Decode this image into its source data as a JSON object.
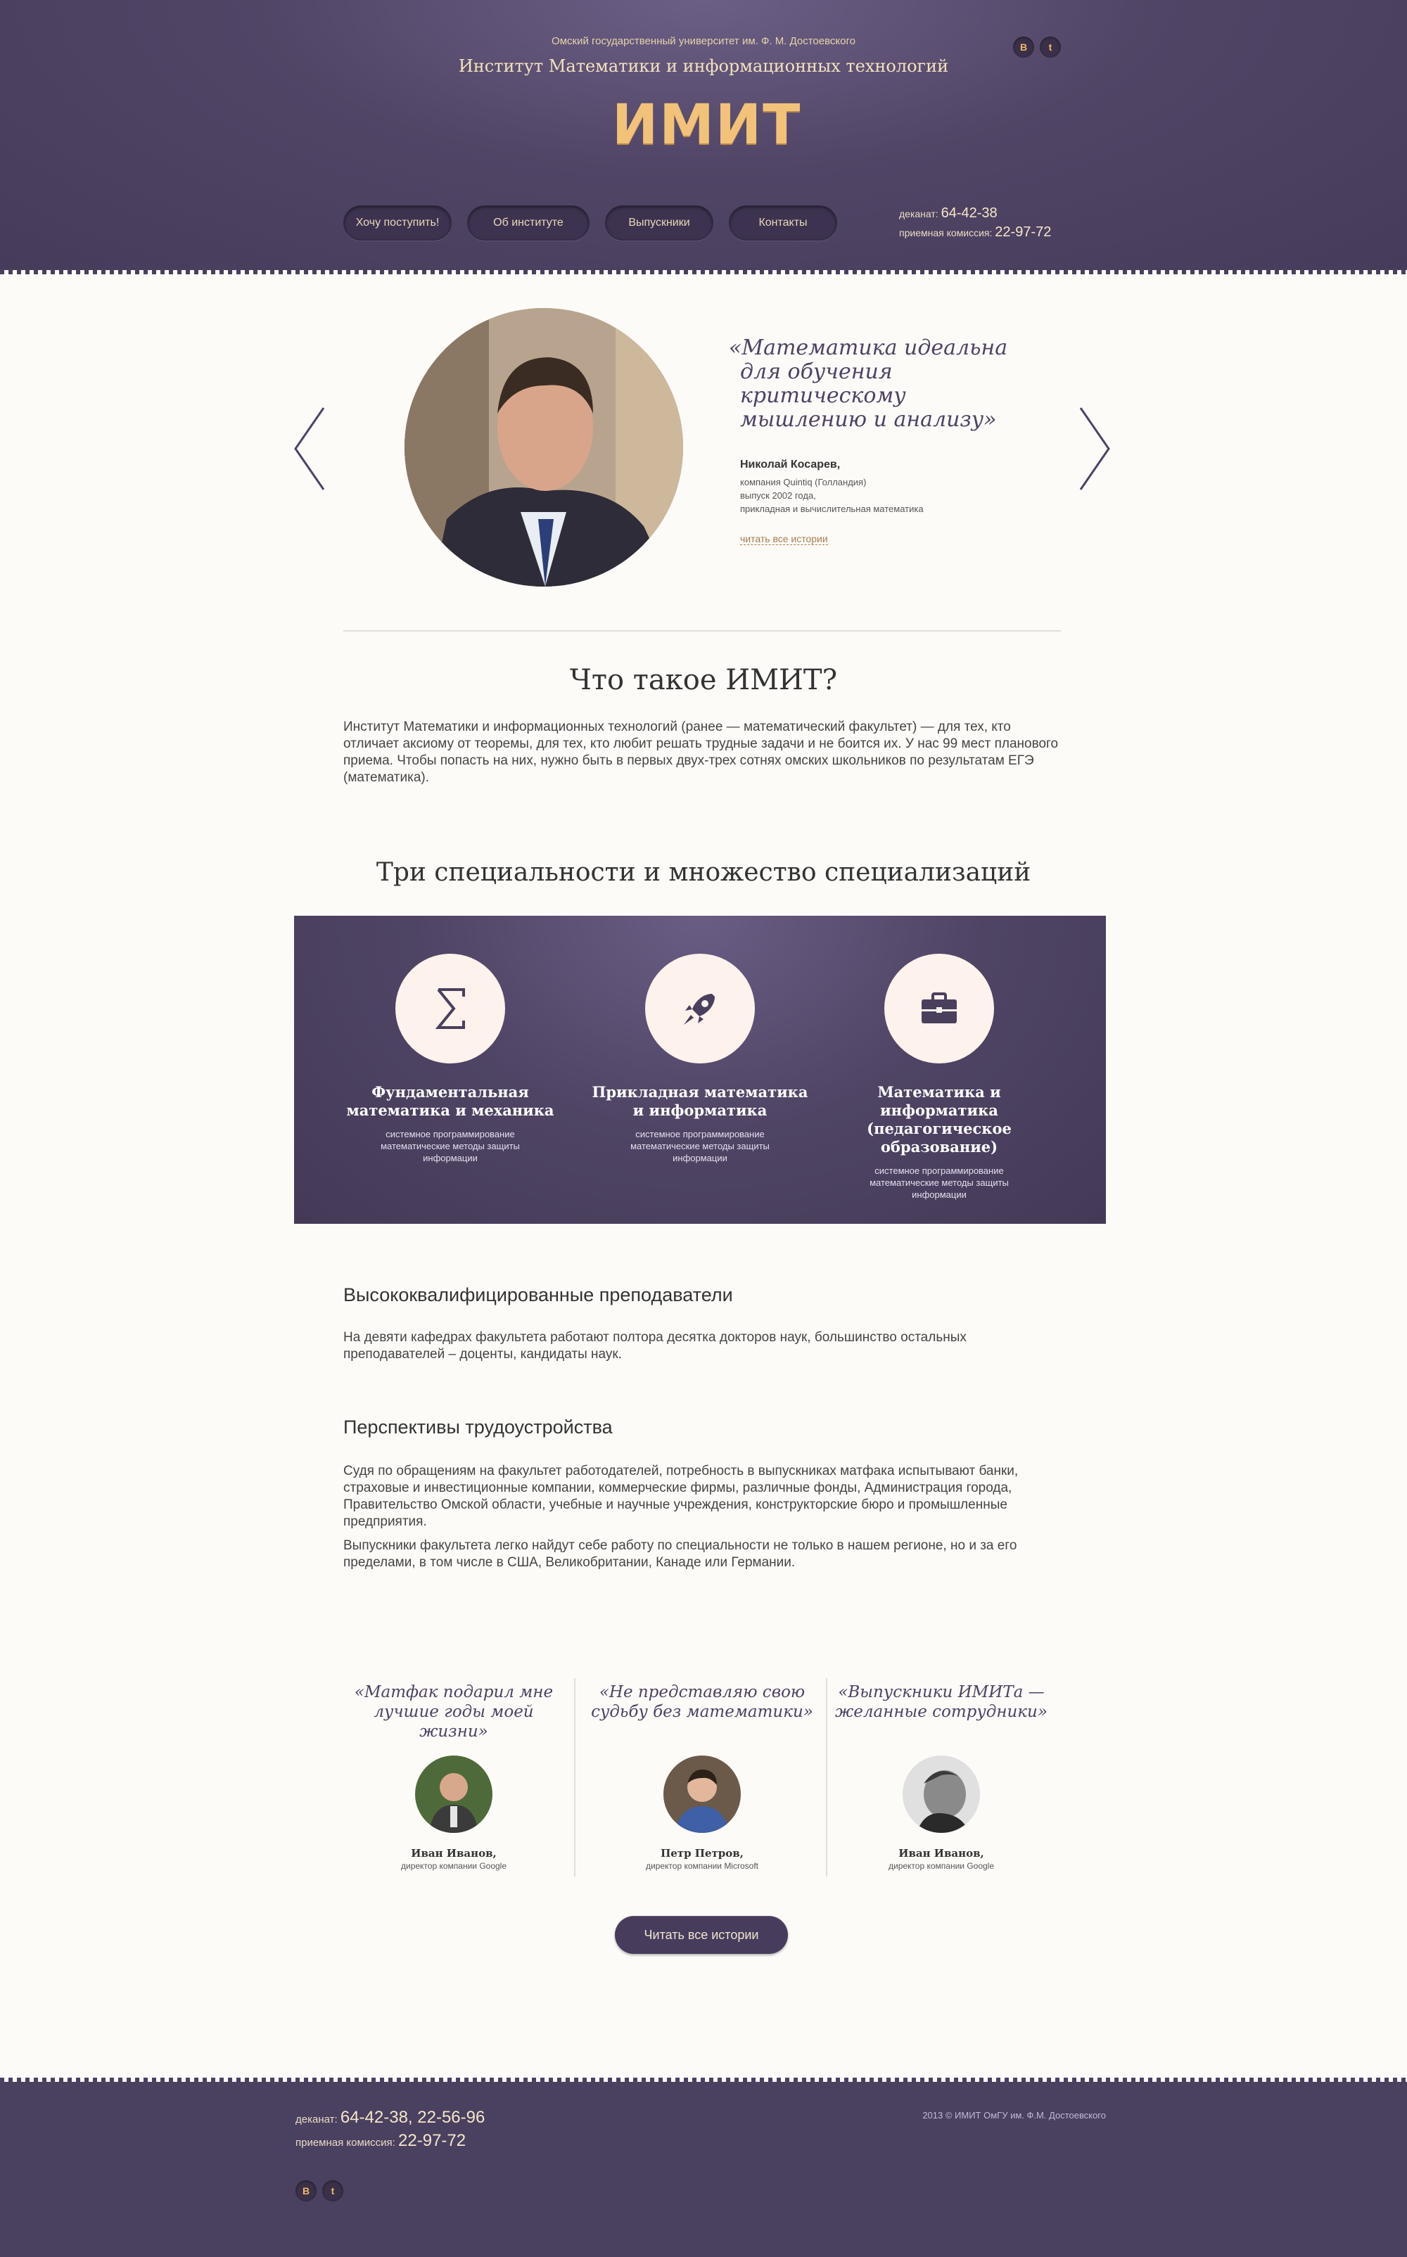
{
  "header": {
    "university": "Омский государственный университет им. Ф. М. Достоевского",
    "institute": "Институт Математики и информационных технологий",
    "logo": "ИМИТ",
    "socials": [
      {
        "icon": "vk-icon",
        "label": "B"
      },
      {
        "icon": "twitter-icon",
        "label": "t"
      }
    ],
    "nav": [
      "Хочу поступить!",
      "Об институте",
      "Выпускники",
      "Контакты"
    ],
    "dean_label": "деканат:",
    "dean_phone": "64-42-38",
    "admission_label": "приемная комиссия:",
    "admission_phone": "22-97-72"
  },
  "slider": {
    "quote": "«Математика идеальна для обучения критическому мышлению и анализу»",
    "quote_lines": [
      "«Математика идеальна",
      "для обучения",
      "критическому",
      "мышлению и анализу»"
    ],
    "name": "Николай Косарев,",
    "company": "компания Quintiq (Голландия)",
    "graduation": "выпуск 2002 года,",
    "specialty": "прикладная и вычислительная математика",
    "link": "читать все истории"
  },
  "about": {
    "title": "Что такое ИМИТ?",
    "text": "Институт Математики и информационных технологий (ранее — математический факультет) — для тех, кто отличает аксиому от теоремы, для тех, кто любит решать трудные задачи и не боится их. У нас 99 мест планового приема. Чтобы попасть на них, нужно быть в первых двух-трех сотнях омских школьников по результатам ЕГЭ (математика)."
  },
  "specialties": {
    "title": "Три специальности и множество специализаций",
    "items": [
      {
        "icon": "sigma-icon",
        "title_lines": [
          "Фундаментальная",
          "математика и механика"
        ],
        "lines": [
          "системное программирование",
          "математические методы защиты",
          "информации"
        ]
      },
      {
        "icon": "rocket-icon",
        "title_lines": [
          "Прикладная математика",
          "и информатика"
        ],
        "lines": [
          "системное программирование",
          "математические методы защиты",
          "информации"
        ]
      },
      {
        "icon": "briefcase-icon",
        "title_lines": [
          "Математика и информатика",
          "(педагогическое образование)"
        ],
        "lines": [
          "системное программирование",
          "математические методы защиты",
          "информации"
        ]
      }
    ]
  },
  "teachers": {
    "title": "Высококвалифицированные преподаватели",
    "text": "На девяти кафедрах факультета работают полтора десятка докторов наук, большинство остальных преподавателей – доценты, кандидаты наук."
  },
  "careers": {
    "title": "Перспективы трудоустройства",
    "p1": "Судя по обращениям на факультет работодателей, потребность в выпускниках матфака испытывают банки, страховые и инвестиционные компании, коммерческие фирмы, различные фонды, Администрация города, Правительство Омской области, учебные и научные учреждения, конструкторские бюро и промышленные предприятия.",
    "p2": "Выпускники факультета легко найдут себе работу по специальности не только в нашем регионе, но и за его пределами, в том числе в США, Великобритании, Канаде или Германии."
  },
  "testimonials": [
    {
      "quote_lines": [
        "«Матфак подарил мне",
        "лучшие годы моей жизни»"
      ],
      "name": "Иван Иванов,",
      "role": "директор компании Google"
    },
    {
      "quote_lines": [
        "«Не представляю свою",
        "судьбу без математики»"
      ],
      "name": "Петр Петров,",
      "role": "директор компании Microsoft"
    },
    {
      "quote_lines": [
        "«Выпускники ИМИТа —",
        "желанные сотрудники»"
      ],
      "name": "Иван Иванов,",
      "role": "директор компании Google"
    }
  ],
  "all_stories_button": "Читать все истории",
  "footer": {
    "dean_label": "деканат:",
    "dean_phones": "64-42-38, 22-56-96",
    "admission_label": "приемная комиссия:",
    "admission_phone": "22-97-72",
    "copyright": "2013 © ИМИТ ОмГУ им. Ф.М. Достоевского",
    "socials": [
      {
        "icon": "vk-icon",
        "label": "B"
      },
      {
        "icon": "twitter-icon",
        "label": "t"
      }
    ]
  },
  "colors": {
    "header_bg": "#514566",
    "accent_gold": "#f2c27a",
    "page_bg": "#fdfbf8",
    "link": "#a47d4d"
  }
}
